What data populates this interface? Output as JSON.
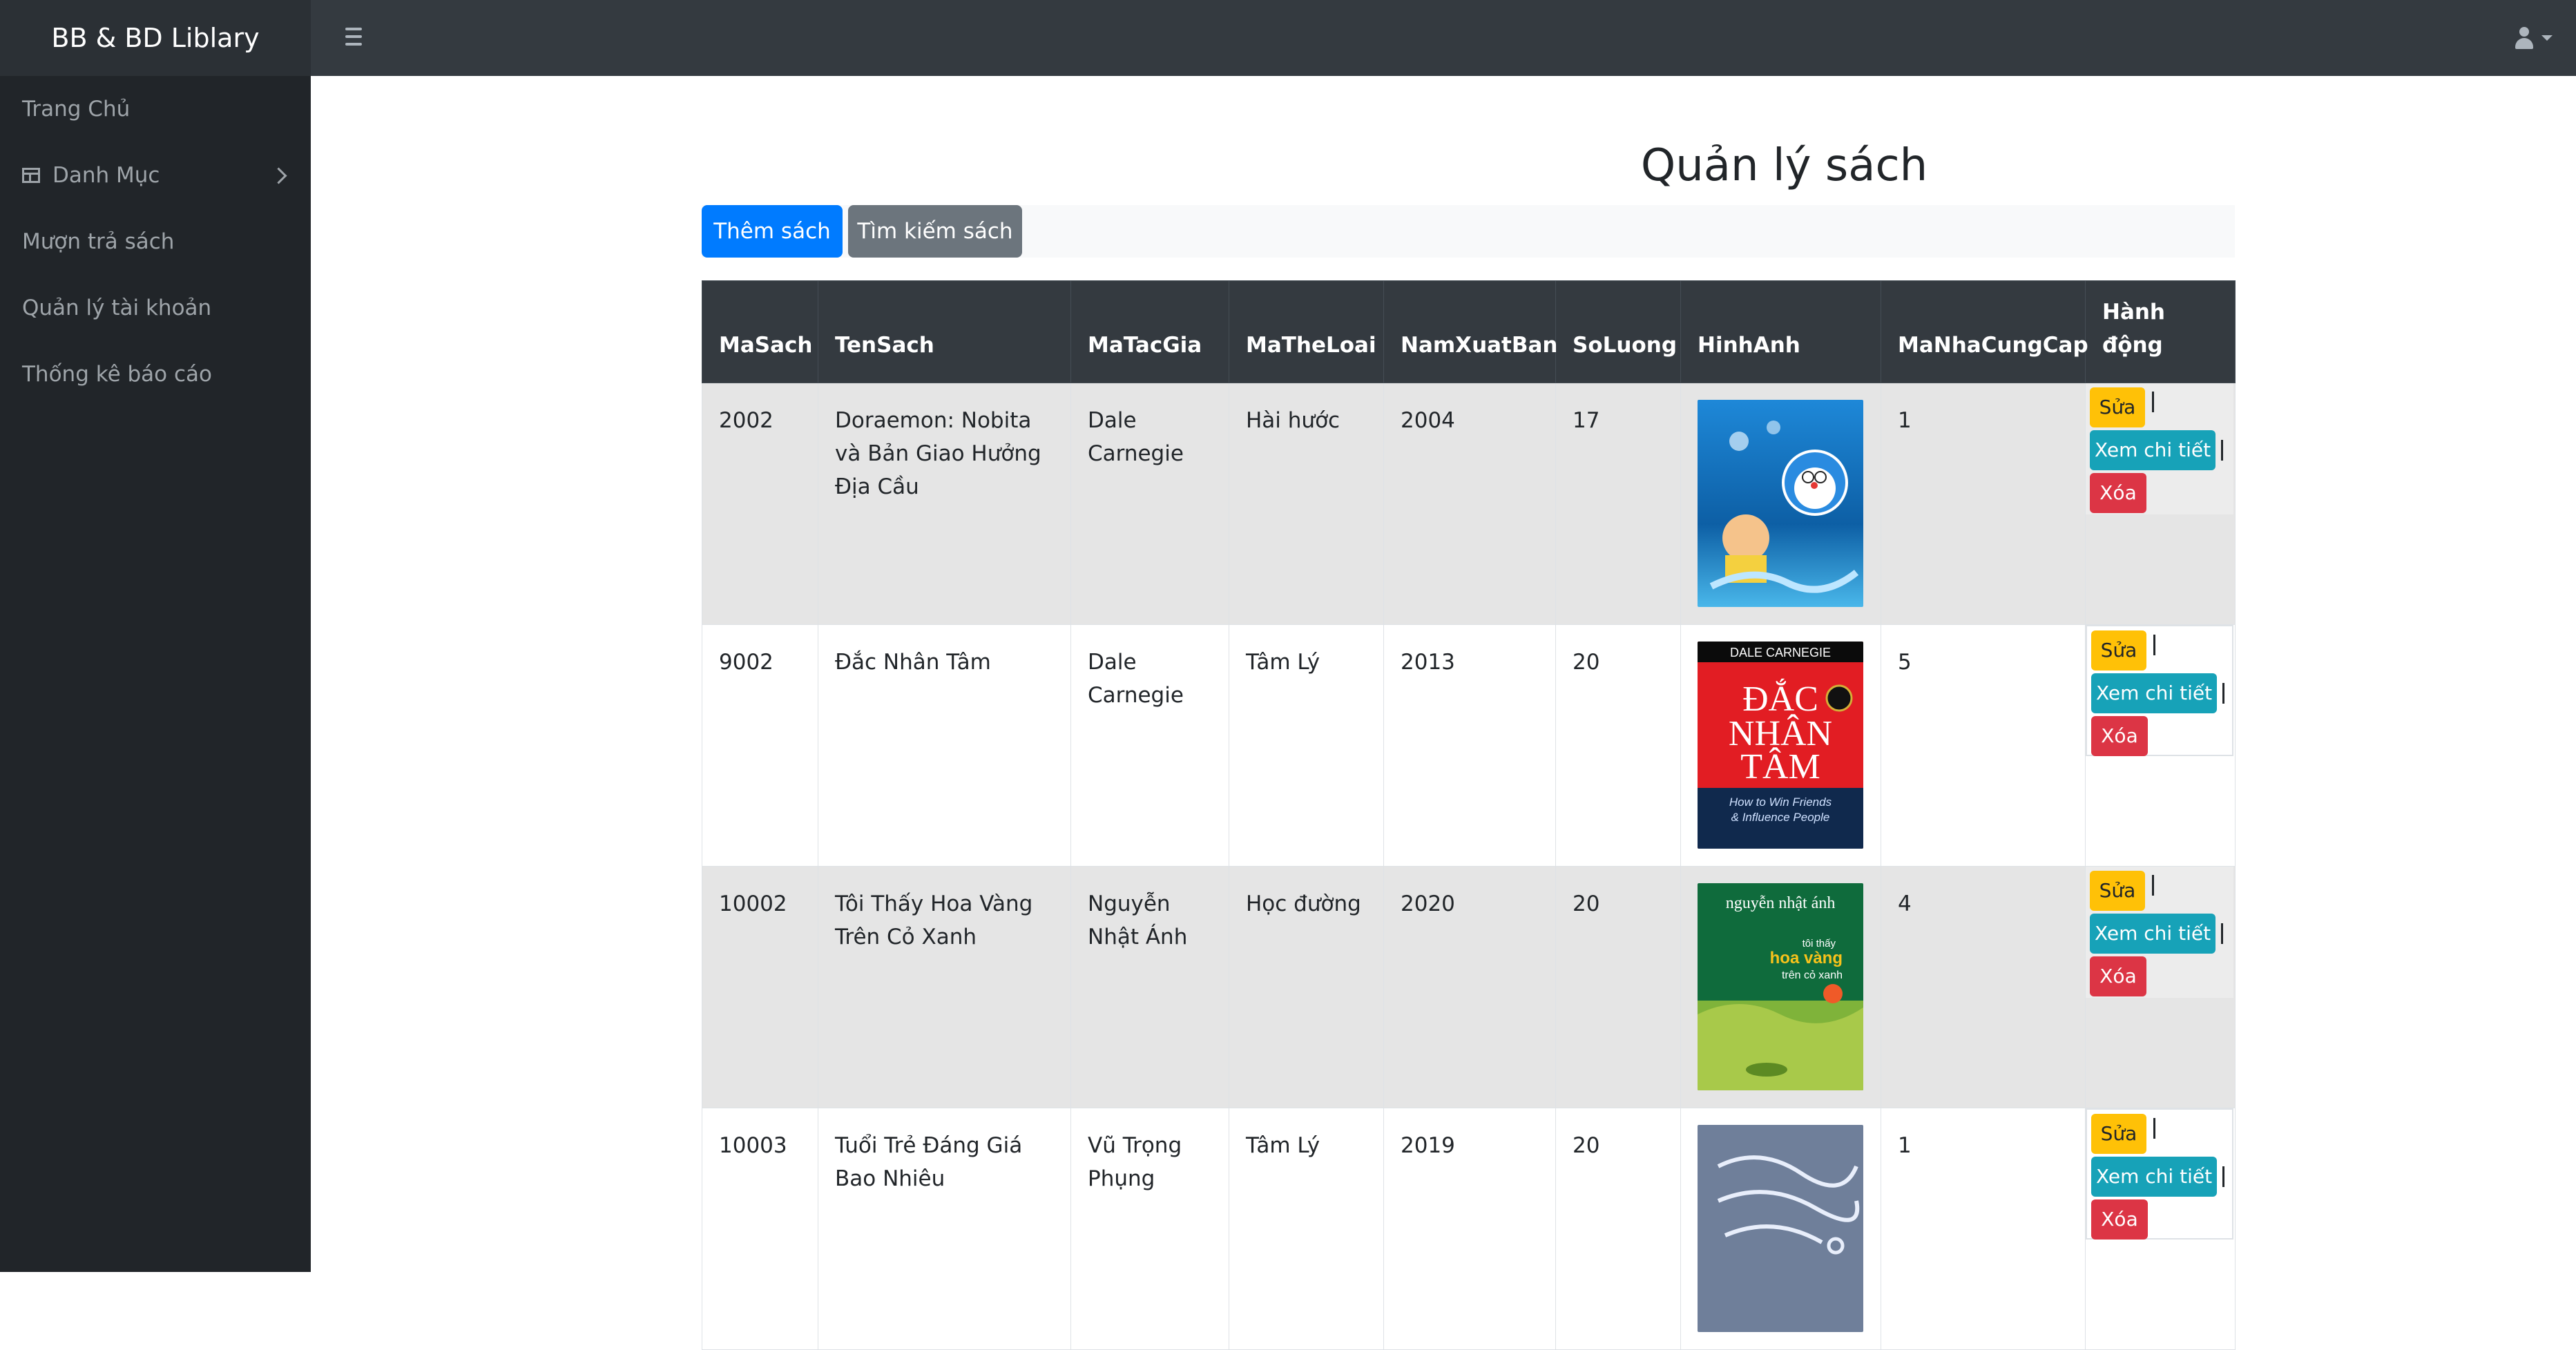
{
  "header": {
    "brand": "BB & BD Liblary"
  },
  "sidebar": {
    "items": [
      {
        "label": "Trang Chủ"
      },
      {
        "label": "Danh Mục"
      },
      {
        "label": "Mượn trả sách"
      },
      {
        "label": "Quản lý tài khoản"
      },
      {
        "label": "Thống kê báo cáo"
      }
    ]
  },
  "main": {
    "title": "Quản lý sách",
    "add_button": "Thêm sách",
    "search_button": "Tìm kiếm sách"
  },
  "table": {
    "headers": [
      "MaSach",
      "TenSach",
      "MaTacGia",
      "MaTheLoai",
      "NamXuatBan",
      "SoLuong",
      "HinhAnh",
      "MaNhaCungCap",
      "Hành động"
    ],
    "actions": {
      "edit": "Sửa",
      "view": "Xem chi tiết",
      "delete": "Xóa"
    },
    "rows": [
      {
        "masach": "2002",
        "tensach": "Doraemon: Nobita và Bản Giao Hưởng Địa Cầu",
        "matacgia": "Dale Carnegie",
        "matheloai": "Hài hước",
        "nam": "2004",
        "soluong": "17",
        "manhacungcap": "1"
      },
      {
        "masach": "9002",
        "tensach": "Đắc Nhân Tâm",
        "matacgia": "Dale Carnegie",
        "matheloai": "Tâm Lý",
        "nam": "2013",
        "soluong": "20",
        "manhacungcap": "5"
      },
      {
        "masach": "10002",
        "tensach": "Tôi Thấy Hoa Vàng Trên Cỏ Xanh",
        "matacgia": "Nguyễn Nhật Ánh",
        "matheloai": "Học đường",
        "nam": "2020",
        "soluong": "20",
        "manhacungcap": "4"
      },
      {
        "masach": "10003",
        "tensach": "Tuổi Trẻ Đáng Giá Bao Nhiêu",
        "matacgia": "Vũ Trọng Phụng",
        "matheloai": "Tâm Lý",
        "nam": "2019",
        "soluong": "20",
        "manhacungcap": "1"
      }
    ]
  },
  "covers": {
    "c2": {
      "top": "DALE CARNEGIE",
      "title1": "ĐẮC",
      "title2": "NHÂN",
      "title3": "TÂM",
      "sub1": "How to Win Friends",
      "sub2": "& Influence People"
    },
    "c3": {
      "author": "nguyễn nhật ánh",
      "t1": "tôi thấy",
      "t2": "hoa vàng",
      "t3": "trên cỏ xanh"
    }
  },
  "colors": {
    "topbar": "#343a40",
    "sidebar": "#212529",
    "primary": "#007bff",
    "secondary": "#6c757d",
    "warning": "#ffc107",
    "info": "#17a2b8",
    "danger": "#dc3545"
  }
}
